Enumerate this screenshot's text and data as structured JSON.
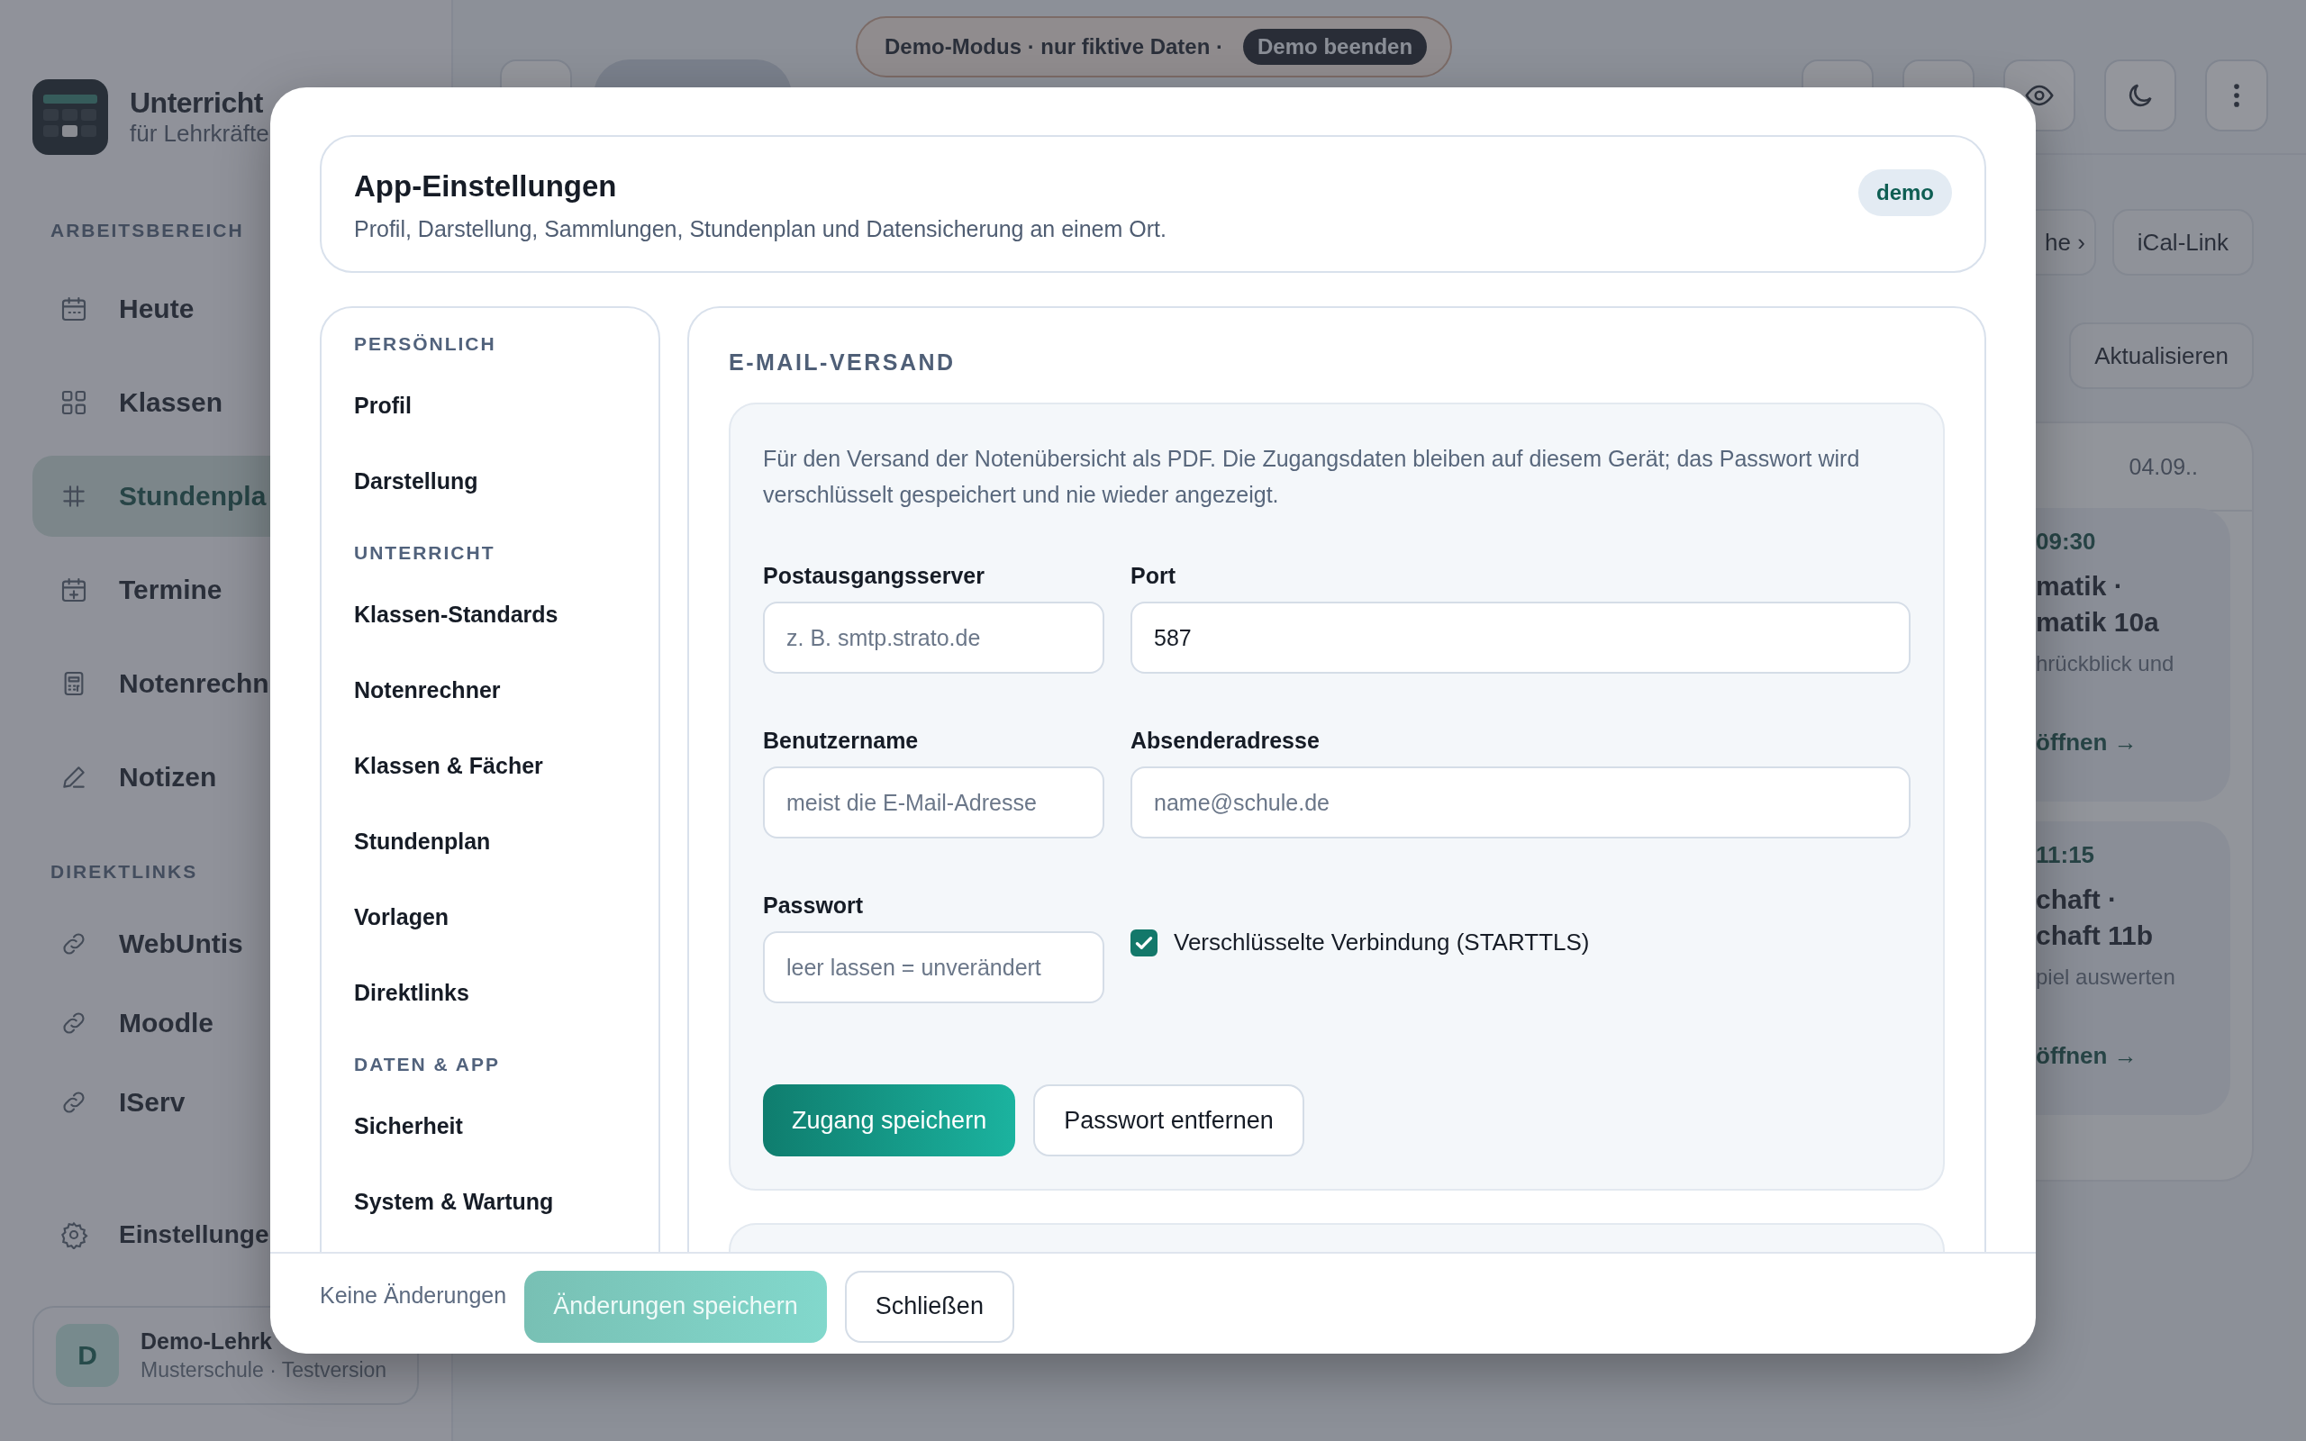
{
  "app": {
    "brand": {
      "name": "Unterricht",
      "subtitle": "für Lehrkräfte"
    },
    "sidebar": [
      {
        "heading": "ARBEITSBEREICH",
        "items": [
          {
            "label": "Heute",
            "selected": false
          },
          {
            "label": "Klassen",
            "selected": false
          },
          {
            "label": "Stundenpla",
            "selected": true
          },
          {
            "label": "Termine",
            "selected": false
          },
          {
            "label": "Notenrechn",
            "selected": false
          },
          {
            "label": "Notizen",
            "selected": false
          }
        ]
      },
      {
        "heading": "DIREKTLINKS",
        "items": [
          {
            "label": "WebUntis",
            "selected": false
          },
          {
            "label": "Moodle",
            "selected": false
          },
          {
            "label": "IServ",
            "selected": false
          }
        ]
      }
    ],
    "settings_link": "Einstellunge",
    "user": {
      "initial": "D",
      "name": "Demo-Lehrk",
      "subtitle": "Musterschule · Testversion"
    }
  },
  "demo_banner": {
    "text": "Demo-Modus · nur fiktive Daten ·",
    "button": "Demo beenden"
  },
  "right_panel": {
    "buttons": [
      "he ›",
      "iCal-Link"
    ],
    "refresh_button": "Aktualisieren",
    "date": "04.09..",
    "lessons": [
      {
        "time": "09:30",
        "title": [
          "matik ·",
          "matik 10a"
        ],
        "note": "hrückblick und",
        "link": "öffnen →"
      },
      {
        "time": "11:15",
        "title": [
          "chaft ·",
          "chaft 11b"
        ],
        "note": "piel auswerten",
        "link": "öffnen →"
      }
    ]
  },
  "dialog": {
    "title": "App-Einstellungen",
    "subtitle": "Profil, Darstellung, Sammlungen, Stundenplan und Datensicherung an einem Ort.",
    "badge": "demo",
    "nav": [
      {
        "heading": "PERSÖNLICH",
        "items": [
          "Profil",
          "Darstellung"
        ]
      },
      {
        "heading": "UNTERRICHT",
        "items": [
          "Klassen-Standards",
          "Notenrechner",
          "Klassen & Fächer",
          "Stundenplan",
          "Vorlagen",
          "Direktlinks"
        ]
      },
      {
        "heading": "DATEN & APP",
        "items": [
          "Sicherheit",
          "System & Wartung"
        ]
      }
    ],
    "section": {
      "title": "E-MAIL-VERSAND",
      "description": "Für den Versand der Notenübersicht als PDF. Die Zugangsdaten bleiben auf diesem Gerät; das Passwort wird verschlüsselt gespeichert und nie wieder angezeigt.",
      "fields": [
        {
          "label": "Postausgangsserver",
          "placeholder": "z. B. smtp.strato.de"
        },
        {
          "label": "Port",
          "value": "587"
        },
        {
          "label": "Benutzername",
          "placeholder": "meist die E-Mail-Adresse"
        },
        {
          "label": "Absenderadresse",
          "placeholder": "name@schule.de"
        },
        {
          "label": "Passwort",
          "placeholder": "leer lassen = unverändert"
        }
      ],
      "checkbox": {
        "label": "Verschlüsselte Verbindung (STARTTLS)",
        "checked": true
      },
      "save_button": "Zugang speichern",
      "remove_button": "Passwort entfernen"
    },
    "footer": {
      "status": "Keine Änderungen",
      "save_button": {
        "label": "Änderungen speichern",
        "disabled": true
      },
      "close_button": "Schließen"
    }
  }
}
